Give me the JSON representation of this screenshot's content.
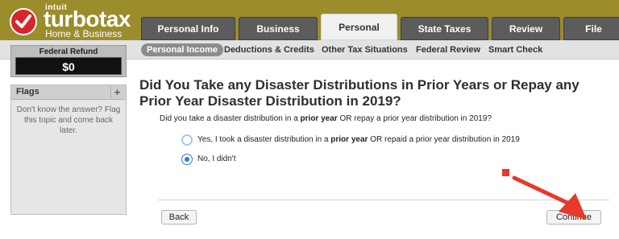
{
  "brand": {
    "company": "intuit",
    "product": "turbotax",
    "edition": "Home & Business"
  },
  "tabs": [
    {
      "label": "Personal Info",
      "active": false
    },
    {
      "label": "Business",
      "active": false
    },
    {
      "label": "Personal",
      "active": true
    },
    {
      "label": "State Taxes",
      "active": false
    },
    {
      "label": "Review",
      "active": false
    },
    {
      "label": "File",
      "active": false
    }
  ],
  "subnav": [
    {
      "label": "Personal Income",
      "active": true
    },
    {
      "label": "Deductions & Credits",
      "active": false
    },
    {
      "label": "Other Tax Situations",
      "active": false
    },
    {
      "label": "Federal Review",
      "active": false
    },
    {
      "label": "Smart Check",
      "active": false
    }
  ],
  "refund": {
    "label": "Federal Refund",
    "amount": "$0"
  },
  "flags": {
    "title": "Flags",
    "plus": "+",
    "help_text": "Don't know the answer? Flag this topic and come back later."
  },
  "main": {
    "question": "Did You Take any Disaster Distributions in Prior Years or Repay any Prior Year Disaster Distribution in 2019?",
    "sub_question": {
      "pre": "Did you take a disaster distribution in a ",
      "bold": "prior year",
      "post": " OR repay a prior year distribution in 2019?"
    },
    "options": [
      {
        "pre": "Yes, I took a disaster distribution in a ",
        "bold": "prior year",
        "post": " OR repaid a prior year distribution in 2019",
        "selected": false
      },
      {
        "pre": "No, I didn't",
        "bold": "",
        "post": "",
        "selected": true
      }
    ]
  },
  "buttons": {
    "back": "Back",
    "continue": "Continue"
  },
  "colors": {
    "header": "#9b8c2c",
    "tab_dark": "#5c5c5c",
    "radio_selected": "#2d78dd",
    "annotation_arrow": "#e8392b"
  },
  "icons": {
    "logo": "checkmark-circle-icon",
    "annotation": "red-arrow-icon"
  }
}
